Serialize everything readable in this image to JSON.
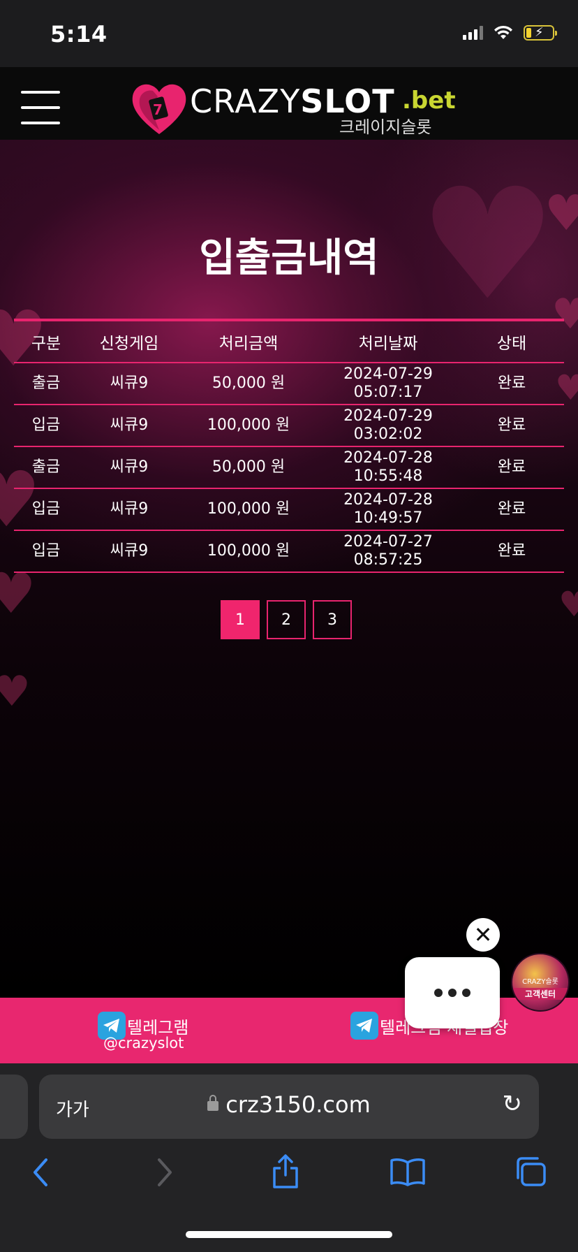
{
  "status_bar": {
    "time": "5:14"
  },
  "header": {
    "logo": {
      "crazy": "CRAZY",
      "slot": "SLOT",
      "bet": ".bet",
      "korean": "크레이지슬롯"
    }
  },
  "page": {
    "title": "입출금내역",
    "table": {
      "headers": [
        "구분",
        "신청게임",
        "처리금액",
        "처리날짜",
        "상태"
      ],
      "rows": [
        {
          "type": "출금",
          "game": "씨큐9",
          "amount": "50,000 원",
          "date": "2024-07-29",
          "time": "05:07:17",
          "status": "완료"
        },
        {
          "type": "입금",
          "game": "씨큐9",
          "amount": "100,000 원",
          "date": "2024-07-29",
          "time": "03:02:02",
          "status": "완료"
        },
        {
          "type": "출금",
          "game": "씨큐9",
          "amount": "50,000 원",
          "date": "2024-07-28",
          "time": "10:55:48",
          "status": "완료"
        },
        {
          "type": "입금",
          "game": "씨큐9",
          "amount": "100,000 원",
          "date": "2024-07-28",
          "time": "10:49:57",
          "status": "완료"
        },
        {
          "type": "입금",
          "game": "씨큐9",
          "amount": "100,000 원",
          "date": "2024-07-27",
          "time": "08:57:25",
          "status": "완료"
        }
      ]
    },
    "pagination": {
      "pages": [
        "1",
        "2",
        "3"
      ],
      "current": "1"
    }
  },
  "chat_widget": {
    "close_glyph": "✕",
    "cs_brand": "CRAZY슬롯",
    "cs_label": "고객센터"
  },
  "telegram_bar": {
    "left": {
      "label": "텔레그램",
      "handle": "@crazyslot"
    },
    "right": {
      "label": "텔레그램 채널입장"
    }
  },
  "browser": {
    "aa": "가가",
    "url": "crz3150.com",
    "icons": {
      "back": "chevron-left",
      "forward": "chevron-right",
      "share": "share",
      "bookmarks": "book",
      "tabs": "tabs"
    }
  },
  "colors": {
    "accent": "#e8246e",
    "active_page": "#f0256d",
    "telegram_bar": "#e8276f",
    "logo_bet": "#c9d631",
    "safari_blue": "#3b8cf5"
  }
}
